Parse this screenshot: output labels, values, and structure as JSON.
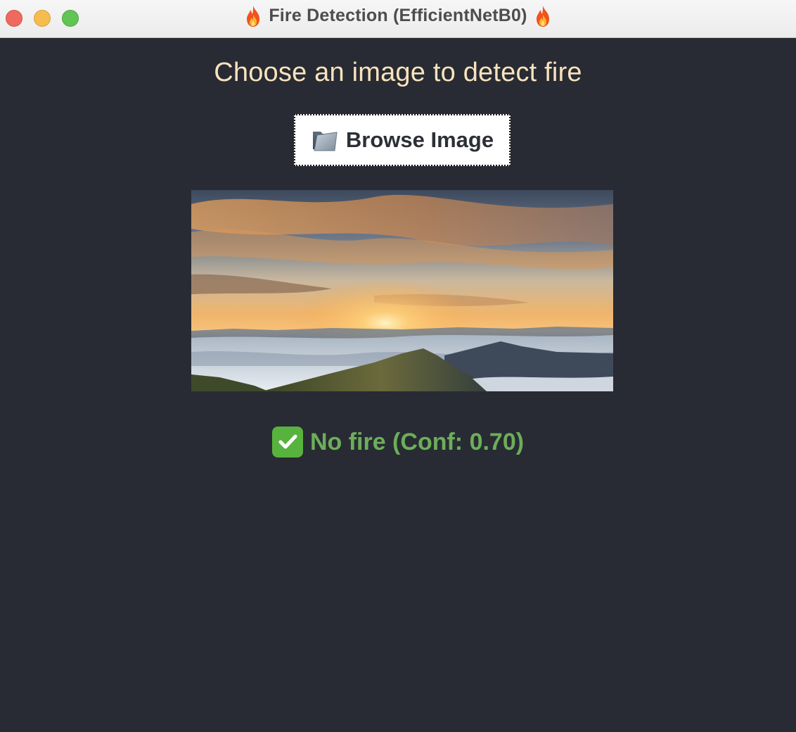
{
  "window": {
    "title": "Fire Detection (EfficientNetB0)",
    "title_icon": "fire-icon"
  },
  "main": {
    "heading": "Choose an image to detect fire",
    "browse_button": {
      "icon": "folder-icon",
      "label": "Browse Image"
    },
    "preview_image": "sunset-over-mountains-and-clouds",
    "result": {
      "icon": "checkmark-icon",
      "text": "No fire (Conf: 0.70)",
      "color": "#6cae5a"
    }
  },
  "colors": {
    "background": "#282b33",
    "heading": "#f8e3bd",
    "accent_green": "#57b33d"
  }
}
